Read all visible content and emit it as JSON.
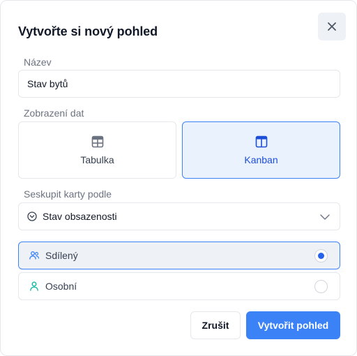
{
  "dialog": {
    "title": "Vytvořte si nový pohled",
    "close_icon": "close-icon"
  },
  "name_field": {
    "label": "Název",
    "value": "Stav bytů"
  },
  "view_type": {
    "label": "Zobrazení dat",
    "options": [
      {
        "label": "Tabulka",
        "icon": "table-icon",
        "selected": false
      },
      {
        "label": "Kanban",
        "icon": "kanban-icon",
        "selected": true
      }
    ]
  },
  "group_by": {
    "label": "Seskupit karty podle",
    "value": "Stav obsazenosti",
    "icon": "circle-chevron-icon"
  },
  "visibility": {
    "options": [
      {
        "label": "Sdílený",
        "icon": "users-icon",
        "selected": true
      },
      {
        "label": "Osobní",
        "icon": "user-icon",
        "selected": false
      }
    ]
  },
  "actions": {
    "cancel_label": "Zrušit",
    "submit_label": "Vytvořit pohled"
  },
  "colors": {
    "accent": "#3b82f6",
    "selected_bg": "#eaf2fe",
    "teal_icon": "#14b8a6"
  }
}
